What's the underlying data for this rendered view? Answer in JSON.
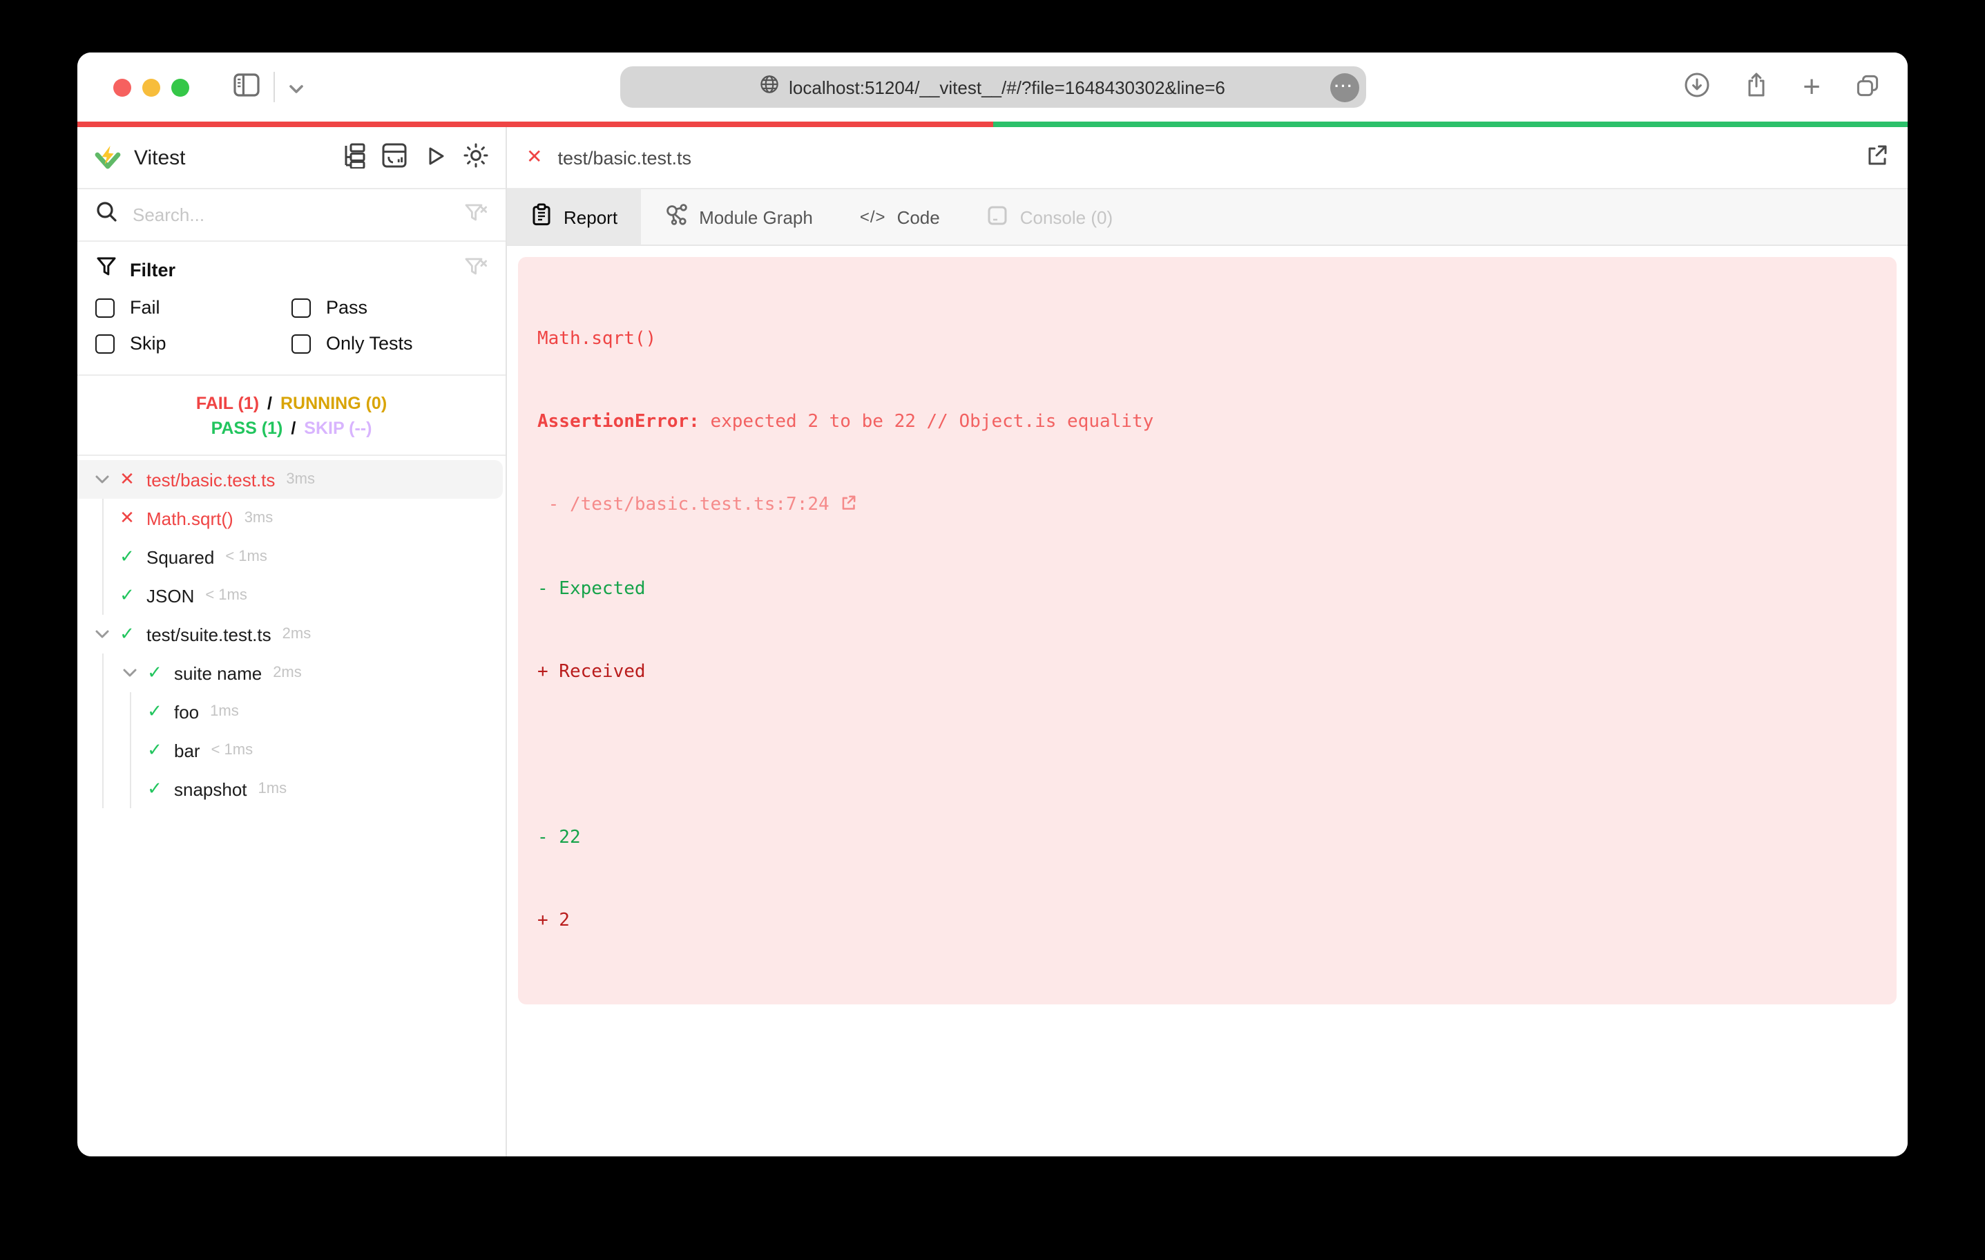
{
  "colors": {
    "accentFail": "#ef4444",
    "accentPass": "#22c55e",
    "accentRunning": "#d9a406",
    "accentSkip": "#d8b4fe",
    "barRed": "#ef4444",
    "barGreen": "#2cc06a",
    "errBg": "#fde8e8",
    "errHead": "#ef4444",
    "errSoft": "#f26161",
    "errPath": "#f58a8a",
    "diffGreen": "#16a34a",
    "diffRed": "#b91c1c"
  },
  "icons": {
    "check": "✓",
    "cross": "✕",
    "code_glyph": "</>",
    "ellipsis": "···",
    "plus": "+"
  },
  "browser": {
    "url": "localhost:51204/__vitest__/#/?file=1648430302&line=6"
  },
  "progress": {
    "fail_width": "width:50%",
    "pass_width": "width:50%"
  },
  "sidebar": {
    "title": "Vitest",
    "search_placeholder": "Search...",
    "filter": {
      "title": "Filter",
      "fail": "Fail",
      "pass": "Pass",
      "skip": "Skip",
      "only_tests": "Only Tests"
    },
    "status": {
      "fail": "FAIL (1)",
      "sep1": "/",
      "running": "RUNNING (0)",
      "pass": "PASS (1)",
      "sep2": "/",
      "skip": "SKIP (--)"
    },
    "tree": [
      {
        "label": "test/basic.test.ts",
        "duration": "3ms"
      },
      {
        "label": "Math.sqrt()",
        "duration": "3ms"
      },
      {
        "label": "Squared",
        "duration": "< 1ms"
      },
      {
        "label": "JSON",
        "duration": "< 1ms"
      },
      {
        "label": "test/suite.test.ts",
        "duration": "2ms"
      },
      {
        "label": "suite name",
        "duration": "2ms"
      },
      {
        "label": "foo",
        "duration": "1ms"
      },
      {
        "label": "bar",
        "duration": "< 1ms"
      },
      {
        "label": "snapshot",
        "duration": "1ms"
      }
    ]
  },
  "main": {
    "file_label": "test/basic.test.ts",
    "tabs": {
      "report": "Report",
      "module_graph": "Module Graph",
      "code": "Code",
      "console": "Console (0)"
    },
    "report": {
      "test_name": "Math.sqrt()",
      "error_name": "AssertionError:",
      "error_message": " expected 2 to be 22 // Object.is equality",
      "stack_prefix": " - ",
      "stack_link": "/test/basic.test.ts:7:24",
      "diff": [
        {
          "text": "- Expected",
          "type": "dgreen"
        },
        {
          "text": "+ Received",
          "type": "dred"
        },
        {
          "text": " ",
          "type": ""
        },
        {
          "text": "- 22",
          "type": "dgreen"
        },
        {
          "text": "+ 2",
          "type": "dred"
        }
      ]
    }
  }
}
